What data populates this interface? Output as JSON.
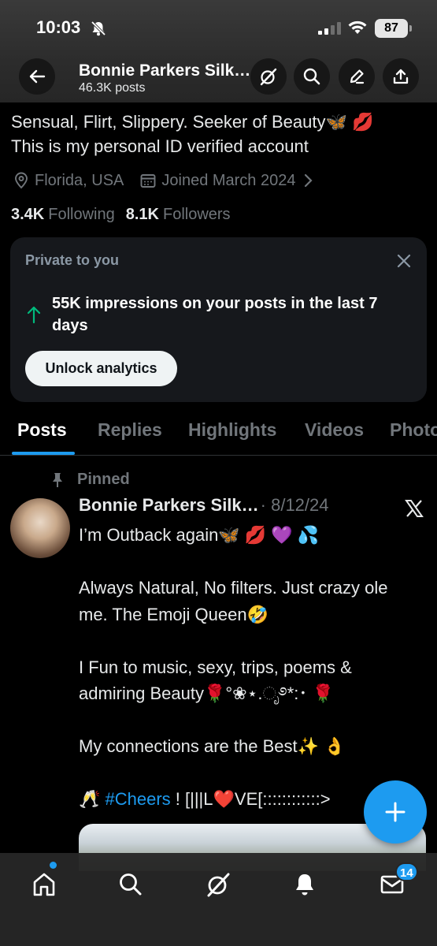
{
  "status_bar": {
    "time": "10:03",
    "battery": "87"
  },
  "header": {
    "name": "Bonnie Parkers Silk…",
    "posts_count": "46.3K posts"
  },
  "bio": {
    "line1": "Sensual, Flirt, Slippery. Seeker of Beauty🦋 💋",
    "line2": "This is my personal ID verified account"
  },
  "meta": {
    "location": "Florida, USA",
    "joined": "Joined March 2024"
  },
  "stats": {
    "following_count": "3.4K",
    "following_label": "Following",
    "followers_count": "8.1K",
    "followers_label": "Followers"
  },
  "private_card": {
    "title": "Private to you",
    "impressions_text": "55K impressions on your posts in the last 7 days",
    "button_label": "Unlock analytics"
  },
  "tabs": [
    "Posts",
    "Replies",
    "Highlights",
    "Videos",
    "Photos"
  ],
  "post": {
    "pinned_label": "Pinned",
    "author": "Bonnie Parkers Silk…",
    "date": "· 8/12/24",
    "lines": [
      "I’m Outback again🦋 💋 💜 💦",
      "",
      "Always Natural, No filters. Just crazy ole me. The Emoji Queen🤣",
      "",
      "I Fun to music, sexy, trips, poems & admiring Beauty🌹°❀⋆.ೃ࿔*:･ 🌹",
      "",
      "My connections are the Best✨ 👌",
      ""
    ],
    "last_line_prefix": "🥂 ",
    "hashtag": "#Cheers",
    "last_line_suffix": " ! [|||L❤️VE[::::::::::::>"
  },
  "bottom_nav": {
    "messages_badge": "14"
  },
  "colors": {
    "accent": "#1d9bf0",
    "background": "#000000",
    "muted": "#71767b",
    "card": "#16181c",
    "positive": "#00ba7c"
  }
}
